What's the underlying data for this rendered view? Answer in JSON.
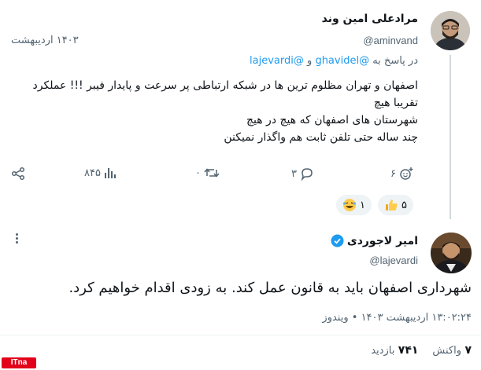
{
  "tweet1": {
    "name": "مرادعلی امین وند",
    "handle": "@aminvand",
    "date": "۱۴۰۳ اردیبهشت",
    "reply_prefix": "در پاسخ به",
    "reply_user1": "@ghavidel",
    "reply_and": "و",
    "reply_user2": "@lajevardi",
    "lines": [
      "اصفهان و تهران مظلوم ترین ها در شبکه ارتباطی پر سرعت و پایدار فیبر !!! عملکرد",
      "تقریبا هیچ",
      "شهرستان های اصفهان که هیچ در هیچ",
      "چند ساله حتی تلفن ثابت هم واگذار نمیکنن"
    ],
    "actions": {
      "reply_count": "۶",
      "repost_count": "۳",
      "like_count": "۰",
      "views_count": "۸۴۵"
    },
    "reactions": [
      {
        "icon": "thumbs-up-emoji",
        "count": "۵"
      },
      {
        "icon": "laughing-emoji",
        "count": "۱"
      }
    ]
  },
  "tweet2": {
    "name": "امیر لاجوردی",
    "handle": "@lajevardi",
    "text": "شهرداری اصفهان باید به قانون عمل کند. به زودی اقدام خواهیم کرد.",
    "meta": "۱۳:۰۲:۲۴ اردیبهشت ۱۴۰۳ • ویندوز",
    "stats": {
      "reactions_count": "۷",
      "reactions_label": "واکنش",
      "views_count": "۷۴۱",
      "views_label": "بازدید"
    }
  },
  "watermark": "ITna",
  "colors": {
    "accent": "#1d9bf0",
    "verified": "#1d9bf0",
    "muted": "#536471",
    "watermark": "#e2001a"
  }
}
